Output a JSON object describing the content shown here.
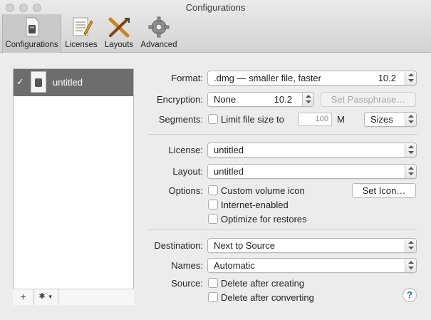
{
  "window": {
    "title": "Configurations"
  },
  "toolbar": {
    "items": [
      {
        "label": "Configurations",
        "icon": "disk-image-icon"
      },
      {
        "label": "Licenses",
        "icon": "document-pen-icon"
      },
      {
        "label": "Layouts",
        "icon": "crossed-tools-icon"
      },
      {
        "label": "Advanced",
        "icon": "gear-icon"
      }
    ]
  },
  "sidebar": {
    "items": [
      {
        "name": "untitled",
        "checked": "✓"
      }
    ],
    "add_label": "+",
    "action_label": "✱"
  },
  "format": {
    "label": "Format:",
    "value": ".dmg — smaller file, faster",
    "version": "10.2"
  },
  "encryption": {
    "label": "Encryption:",
    "value": "None",
    "version": "10.2",
    "passphrase_button": "Set Passphrase…"
  },
  "segments": {
    "label": "Segments:",
    "checkbox_label": "Limit file size to",
    "size_value": "100",
    "unit": "M",
    "sizes_value": "Sizes"
  },
  "license": {
    "label": "License:",
    "value": "untitled"
  },
  "layout": {
    "label": "Layout:",
    "value": "untitled"
  },
  "options": {
    "label": "Options:",
    "checkboxes": [
      "Custom volume icon",
      "Internet-enabled",
      "Optimize for restores"
    ],
    "set_icon_button": "Set Icon…"
  },
  "destination": {
    "label": "Destination:",
    "value": "Next to Source"
  },
  "names": {
    "label": "Names:",
    "value": "Automatic"
  },
  "source": {
    "label": "Source:",
    "checkboxes": [
      "Delete after creating",
      "Delete after converting"
    ]
  },
  "help": {
    "label": "?"
  },
  "colors": {
    "selection": "#6d6d6d",
    "help": "#2a6edb"
  }
}
